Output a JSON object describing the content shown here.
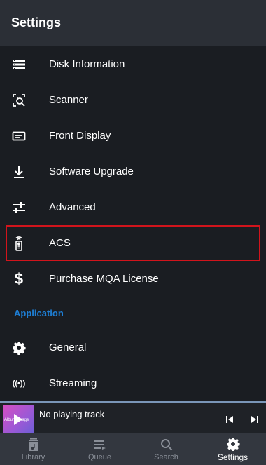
{
  "header": {
    "title": "Settings"
  },
  "items": [
    {
      "label": "Disk Information",
      "icon": "disk-icon"
    },
    {
      "label": "Scanner",
      "icon": "scanner-icon"
    },
    {
      "label": "Front Display",
      "icon": "display-icon"
    },
    {
      "label": "Software Upgrade",
      "icon": "download-icon"
    },
    {
      "label": "Advanced",
      "icon": "sliders-icon"
    },
    {
      "label": "ACS",
      "icon": "remote-icon"
    },
    {
      "label": "Purchase MQA License",
      "icon": "dollar-icon"
    }
  ],
  "section": {
    "label": "Application"
  },
  "app_items": [
    {
      "label": "General",
      "icon": "gear-icon"
    },
    {
      "label": "Streaming",
      "icon": "broadcast-icon"
    }
  ],
  "player": {
    "track": "No playing track",
    "art_text": "Album Image"
  },
  "tabs": [
    {
      "label": "Library",
      "icon": "library-icon"
    },
    {
      "label": "Queue",
      "icon": "queue-icon"
    },
    {
      "label": "Search",
      "icon": "search-icon"
    },
    {
      "label": "Settings",
      "icon": "gear-icon"
    }
  ],
  "colors": {
    "accent": "#1e7fd6",
    "highlight_border": "#d2141c",
    "background": "#1a1d22",
    "header": "#2b2f36",
    "tabbar": "#33373f"
  }
}
